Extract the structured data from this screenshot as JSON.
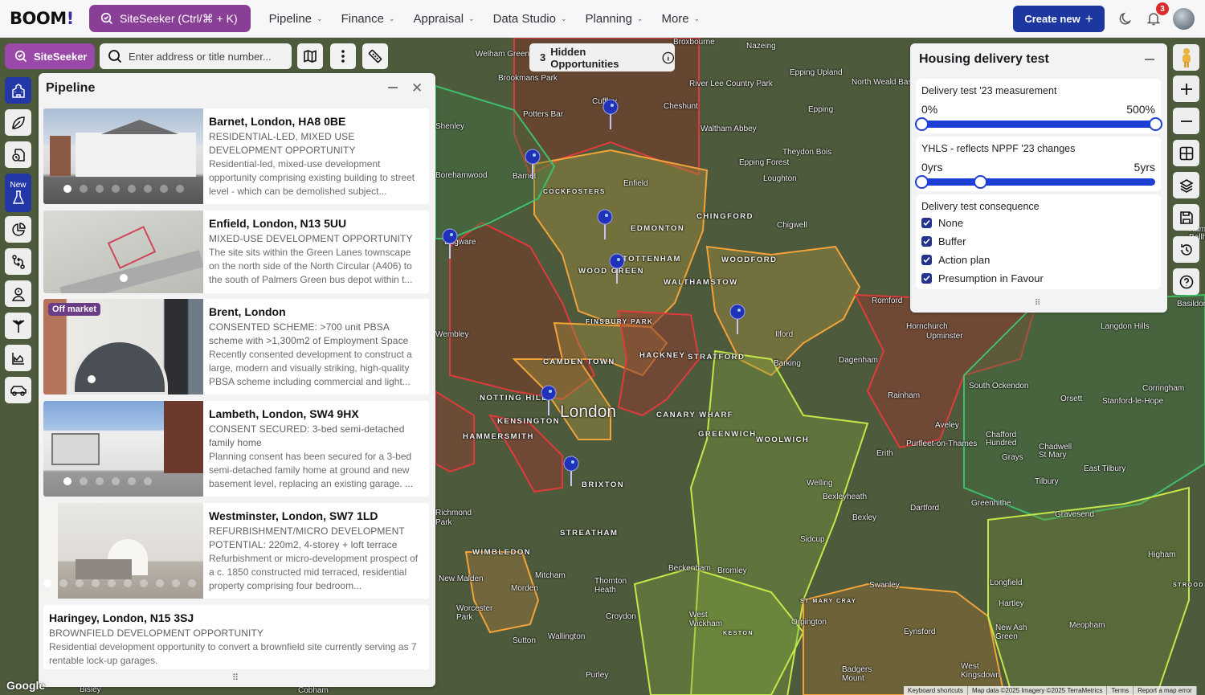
{
  "topbar": {
    "logo": "BOOM",
    "logo_mark": "!",
    "siteseeker_button": "SiteSeeker (Ctrl/⌘ + K)",
    "nav": [
      {
        "label": "Pipeline"
      },
      {
        "label": "Finance"
      },
      {
        "label": "Appraisal"
      },
      {
        "label": "Data Studio"
      },
      {
        "label": "Planning"
      },
      {
        "label": "More"
      }
    ],
    "create_new": "Create new",
    "notification_count": "3"
  },
  "toolbar": {
    "siteseeker_chip": "SiteSeeker",
    "search_placeholder": "Enter address or title number...",
    "search_value": "",
    "icons": [
      "map-icon",
      "more-vertical-icon",
      "ruler-icon"
    ]
  },
  "rail": {
    "items": [
      {
        "icon": "school-building-icon",
        "active": true
      },
      {
        "icon": "leaf-icon"
      },
      {
        "icon": "document-clock-icon"
      },
      {
        "icon": "flask-icon",
        "badge": "New"
      },
      {
        "icon": "pie-chart-icon"
      },
      {
        "icon": "git-compare-icon"
      },
      {
        "icon": "user-location-icon"
      },
      {
        "icon": "antenna-icon"
      },
      {
        "icon": "area-chart-icon"
      },
      {
        "icon": "car-icon"
      }
    ]
  },
  "hidden_opportunities": {
    "count": "3",
    "label": "Hidden Opportunities"
  },
  "pipeline": {
    "title": "Pipeline",
    "cards": [
      {
        "title": "Barnet, London, HA8 0BE",
        "subtitle": "RESIDENTIAL-LED, MIXED USE DEVELOPMENT OPPORTUNITY",
        "description": "Residential-led, mixed-use development opportunity comprising existing building to street level - which can be demolished subject...",
        "badge": "",
        "image_count": 8,
        "active_image": 1
      },
      {
        "title": "Enfield, London, N13 5UU",
        "subtitle": "MIXED-USE DEVELOPMENT OPPORTUNITY",
        "description": "The site sits within the Green Lanes townscape on the north side of the North Circular (A406) to the south of Palmers Green bus depot within t...",
        "badge": "",
        "image_count": 1,
        "active_image": 1
      },
      {
        "title": "Brent, London",
        "subtitle": "CONSENTED SCHEME: >700 unit PBSA scheme with >1,300m2 of Employment Space",
        "description": "Recently consented development to construct a large, modern and visually striking, high-quality PBSA scheme including commercial and light...",
        "badge": "Off market",
        "image_count": 1,
        "active_image": 1
      },
      {
        "title": "Lambeth, London, SW4 9HX",
        "subtitle": "CONSENT SECURED: 3-bed semi-detached family home",
        "description": "Planning consent has been secured for a 3-bed semi-detached family home at ground and new basement level, replacing an existing garage.  ...",
        "badge": "",
        "image_count": 6,
        "active_image": 1
      },
      {
        "title": "Westminster, London, SW7 1LD",
        "subtitle": "REFURBISHMENT/MICRO DEVELOPMENT POTENTIAL: 220m2, 4-storey + loft terrace",
        "description": "Refurbishment or micro-development prospect of a c. 1850 constructed mid terraced, residential property comprising four bedroom...",
        "badge": "",
        "image_count": 10,
        "active_image": 1
      },
      {
        "title": "Haringey, London, N15 3SJ",
        "subtitle": "BROWNFIELD DEVELOPMENT OPPORTUNITY",
        "description": "Residential development opportunity to convert a brownfield site currently serving as 7 rentable lock-up garages.",
        "badge": ""
      }
    ]
  },
  "hdt": {
    "title": "Housing delivery test",
    "measurement": {
      "label": "Delivery test '23 measurement",
      "min_label": "0%",
      "max_label": "500%",
      "range": [
        0,
        500
      ],
      "value": [
        0,
        500
      ]
    },
    "yhls": {
      "label": "YHLS - reflects NPPF '23 changes",
      "min_label": "0yrs",
      "max_label": "5yrs",
      "range": [
        0,
        5
      ],
      "value": [
        0,
        1.25
      ]
    },
    "consequence": {
      "label": "Delivery test consequence",
      "options": [
        {
          "label": "None",
          "checked": true
        },
        {
          "label": "Buffer",
          "checked": true
        },
        {
          "label": "Action plan",
          "checked": true
        },
        {
          "label": "Presumption in Favour",
          "checked": true
        }
      ]
    }
  },
  "map_controls": [
    "pegman-icon",
    "zoom-in-icon",
    "zoom-out-icon",
    "grid-icon",
    "layers-icon",
    "save-icon",
    "history-icon",
    "help-icon"
  ],
  "map": {
    "labels": [
      {
        "text": "London",
        "style": "big"
      },
      {
        "text": "Welham Green"
      },
      {
        "text": "Brookmans Park"
      },
      {
        "text": "Broxbourne"
      },
      {
        "text": "Nazeing"
      },
      {
        "text": "Epping Upland"
      },
      {
        "text": "North Weald Bassett"
      },
      {
        "text": "River Lee Country Park"
      },
      {
        "text": "Cheshunt"
      },
      {
        "text": "Cuffley"
      },
      {
        "text": "Potters Bar"
      },
      {
        "text": "Waltham Abbey"
      },
      {
        "text": "Epping"
      },
      {
        "text": "Theydon Bois"
      },
      {
        "text": "Epping Forest"
      },
      {
        "text": "Loughton"
      },
      {
        "text": "Enfield"
      },
      {
        "text": "Barnet"
      },
      {
        "text": "COCKFOSTERS",
        "style": "caps"
      },
      {
        "text": "Borehamwood"
      },
      {
        "text": "Shenley"
      },
      {
        "text": "Edgware"
      },
      {
        "text": "CHINGFORD",
        "style": "caps"
      },
      {
        "text": "Chigwell"
      },
      {
        "text": "EDMONTON",
        "style": "caps"
      },
      {
        "text": "TOTTENHAM",
        "style": "caps"
      },
      {
        "text": "WOOD GREEN",
        "style": "caps"
      },
      {
        "text": "WOODFORD",
        "style": "caps"
      },
      {
        "text": "WALTHAMSTOW",
        "style": "caps"
      },
      {
        "text": "Romford"
      },
      {
        "text": "FINSBURY PARK",
        "style": "caps"
      },
      {
        "text": "Ilford"
      },
      {
        "text": "Hornchurch"
      },
      {
        "text": "Upminster"
      },
      {
        "text": "Langdon Hills"
      },
      {
        "text": "Wembley"
      },
      {
        "text": "HACKNEY",
        "style": "caps"
      },
      {
        "text": "STRATFORD",
        "style": "caps"
      },
      {
        "text": "Barking"
      },
      {
        "text": "Dagenham"
      },
      {
        "text": "CAMDEN TOWN",
        "style": "caps"
      },
      {
        "text": "Rainham"
      },
      {
        "text": "South Ockendon"
      },
      {
        "text": "Orsett"
      },
      {
        "text": "Corringham"
      },
      {
        "text": "Stanford-le-Hope"
      },
      {
        "text": "NOTTING HILL",
        "style": "caps"
      },
      {
        "text": "KENSINGTON",
        "style": "caps"
      },
      {
        "text": "HAMMERSMITH",
        "style": "caps"
      },
      {
        "text": "CANARY WHARF",
        "style": "caps"
      },
      {
        "text": "GREENWICH",
        "style": "caps"
      },
      {
        "text": "WOOLWICH",
        "style": "caps"
      },
      {
        "text": "Aveley"
      },
      {
        "text": "Purfleet-on-Thames"
      },
      {
        "text": "Chafford Hundred"
      },
      {
        "text": "Chadwell St Mary"
      },
      {
        "text": "Grays"
      },
      {
        "text": "Erith"
      },
      {
        "text": "East Tilbury"
      },
      {
        "text": "Tilbury"
      },
      {
        "text": "BRIXTON",
        "style": "caps"
      },
      {
        "text": "Welling"
      },
      {
        "text": "Bexleyheath"
      },
      {
        "text": "Greenhithe"
      },
      {
        "text": "Dartford"
      },
      {
        "text": "Gravesend"
      },
      {
        "text": "Bexley"
      },
      {
        "text": "Richmond Park"
      },
      {
        "text": "STREATHAM",
        "style": "caps"
      },
      {
        "text": "Sidcup"
      },
      {
        "text": "WIMBLEDON",
        "style": "caps"
      },
      {
        "text": "Higham"
      },
      {
        "text": "New Malden"
      },
      {
        "text": "Mitcham"
      },
      {
        "text": "Morden"
      },
      {
        "text": "Thornton Heath"
      },
      {
        "text": "Beckenham"
      },
      {
        "text": "Bromley"
      },
      {
        "text": "Swanley"
      },
      {
        "text": "Longfield"
      },
      {
        "text": "Worcester Park"
      },
      {
        "text": "Croydon"
      },
      {
        "text": "ST MARY CRAY",
        "style": "caps"
      },
      {
        "text": "Hartley"
      },
      {
        "text": "STROOD",
        "style": "caps"
      },
      {
        "text": "West Wickham"
      },
      {
        "text": "Orpington"
      },
      {
        "text": "Eynsford"
      },
      {
        "text": "New Ash Green"
      },
      {
        "text": "Meopham"
      },
      {
        "text": "Sutton"
      },
      {
        "text": "Wallington"
      },
      {
        "text": "KESTON",
        "style": "caps"
      },
      {
        "text": "Purley"
      },
      {
        "text": "Badgers Mount"
      },
      {
        "text": "West Kingsdown"
      },
      {
        "text": "Bisley"
      },
      {
        "text": "Cobham"
      },
      {
        "text": "Basildon"
      },
      {
        "text": "Ramsden Bellhouse"
      }
    ],
    "attribution": [
      "Keyboard shortcuts",
      "Map data ©2025 Imagery ©2025 TerraMetrics",
      "Terms",
      "Report a map error"
    ],
    "provider": "Google"
  }
}
